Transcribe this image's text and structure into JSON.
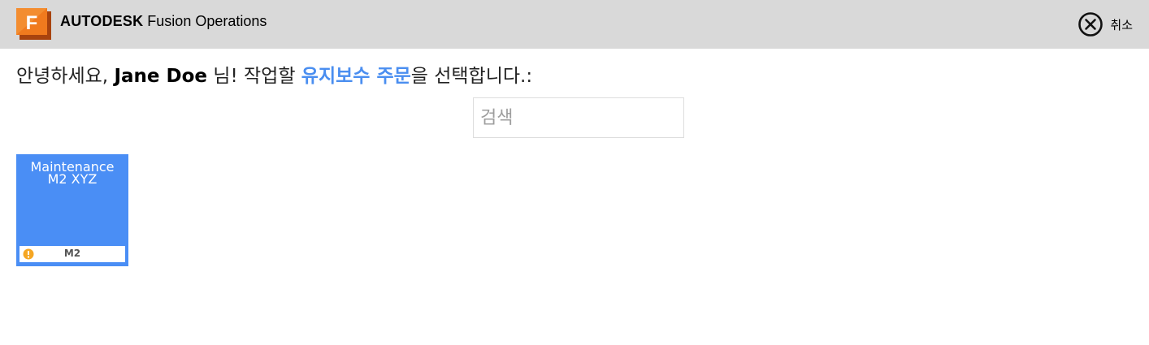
{
  "header": {
    "brand": "AUTODESK",
    "product": "Fusion Operations",
    "logo_letter": "F",
    "logo_icon": "fusion-logo-icon",
    "cancel_label": "취소",
    "cancel_icon": "close-circle-icon"
  },
  "greeting": {
    "prefix": "안녕하세요, ",
    "user_name": "Jane Doe",
    "middle": " 님! 작업할 ",
    "order_type": "유지보수 주문",
    "suffix": "을 선택합니다.:"
  },
  "search": {
    "placeholder": "검색",
    "value": ""
  },
  "orders": [
    {
      "title_line1": "Maintenance",
      "title_line2": "M2 XYZ",
      "code": "M2",
      "status_icon": "warning-icon"
    }
  ],
  "colors": {
    "header_bg": "#d9d9d9",
    "accent": "#4a8ef0",
    "tile_bg": "#4a8ef5",
    "logo_orange": "#f07a1e",
    "warning": "#f5a623"
  }
}
